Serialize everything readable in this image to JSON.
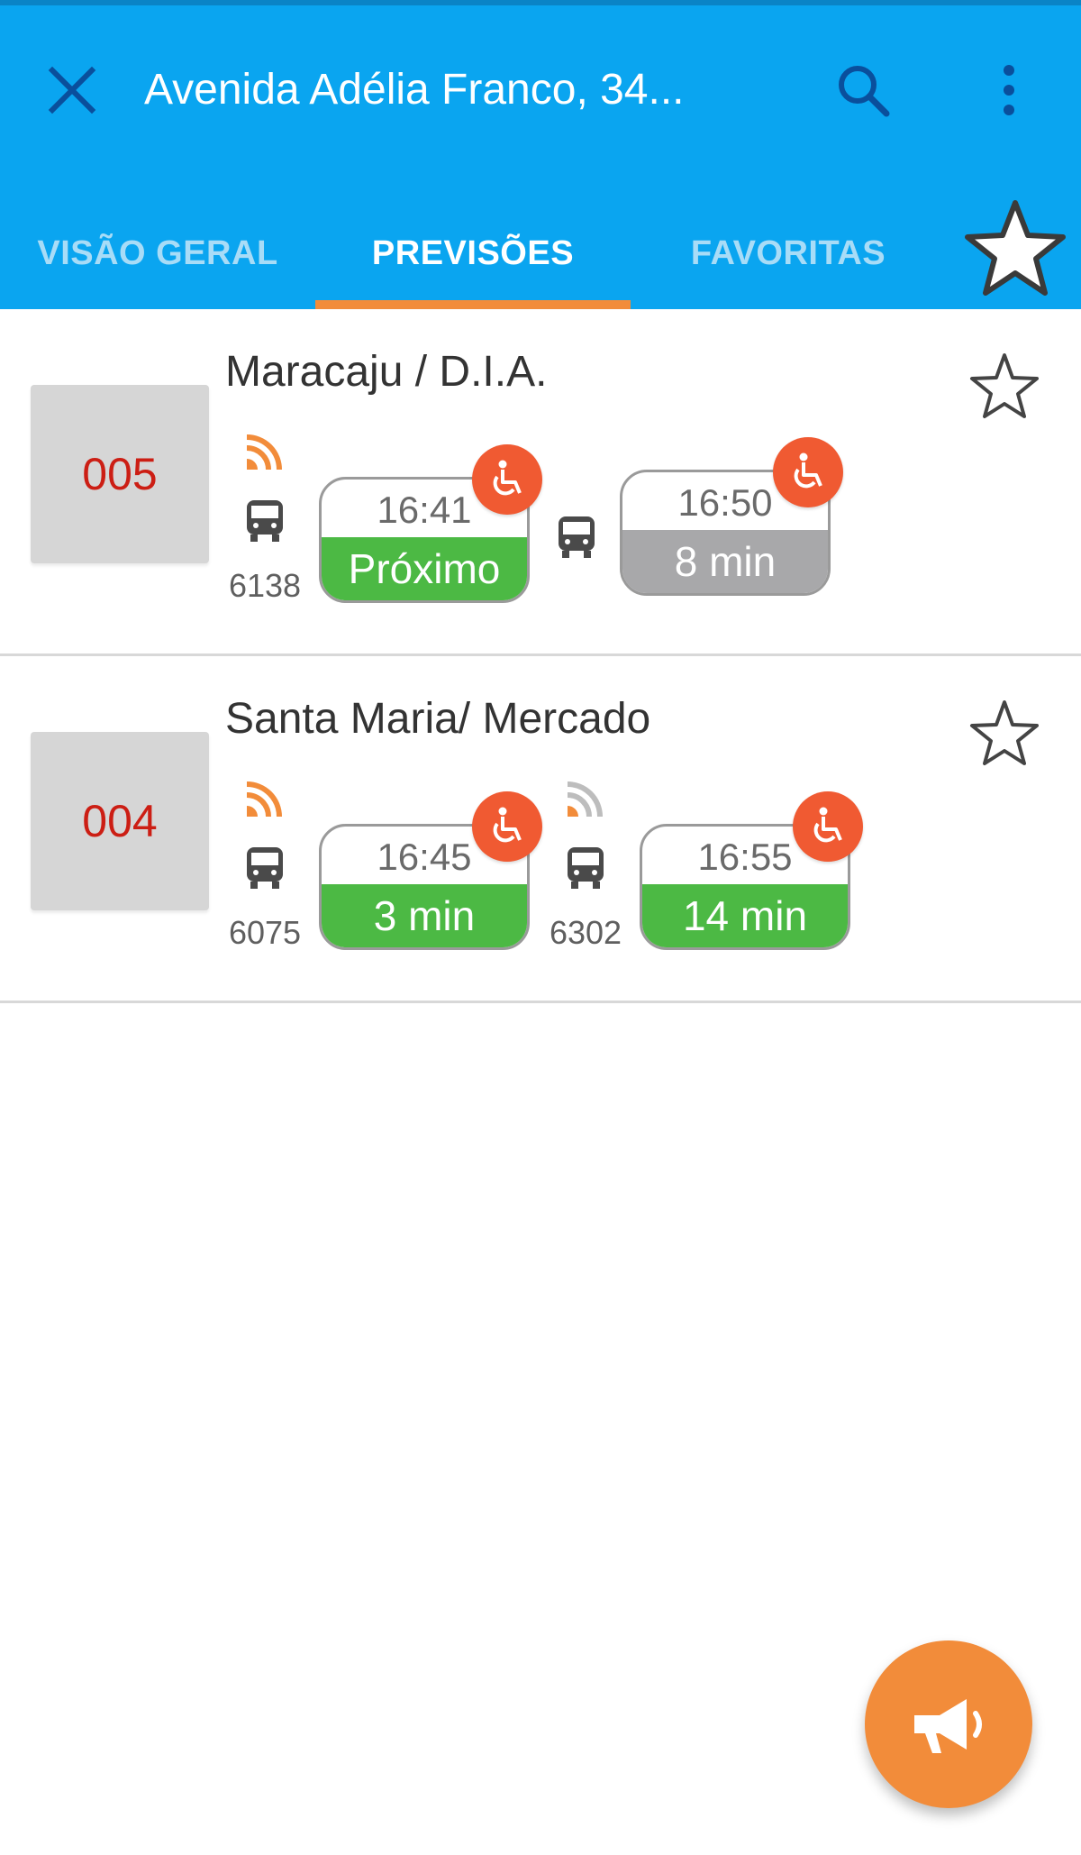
{
  "header": {
    "title": "Avenida Adélia Franco, 34...",
    "close_icon": "close-icon",
    "search_icon": "search-icon",
    "menu_icon": "more-vert-icon",
    "background_color": "#0aa5f0"
  },
  "tabs": [
    {
      "label": "VISÃO GERAL",
      "active": false
    },
    {
      "label": "PREVISÕES",
      "active": true
    },
    {
      "label": "FAVORITAS",
      "active": false
    }
  ],
  "tab_indicator_color": "#f28c3a",
  "routes": [
    {
      "number": "005",
      "name": "Maracaju / D.I.A.",
      "favorite": false,
      "predictions": [
        {
          "vehicle": "6138",
          "realtime": true,
          "time": "16:41",
          "status": "Próximo",
          "status_color": "green",
          "accessible": true
        },
        {
          "vehicle": "",
          "realtime": false,
          "time": "16:50",
          "status": "8 min",
          "status_color": "grey",
          "accessible": true
        }
      ]
    },
    {
      "number": "004",
      "name": "Santa Maria/ Mercado",
      "favorite": false,
      "predictions": [
        {
          "vehicle": "6075",
          "realtime": true,
          "time": "16:45",
          "status": "3 min",
          "status_color": "green",
          "accessible": true
        },
        {
          "vehicle": "6302",
          "realtime": true,
          "time": "16:55",
          "status": "14 min",
          "status_color": "green",
          "accessible": true
        }
      ]
    }
  ],
  "fab": {
    "icon": "megaphone-icon",
    "color": "#f28c3a"
  }
}
